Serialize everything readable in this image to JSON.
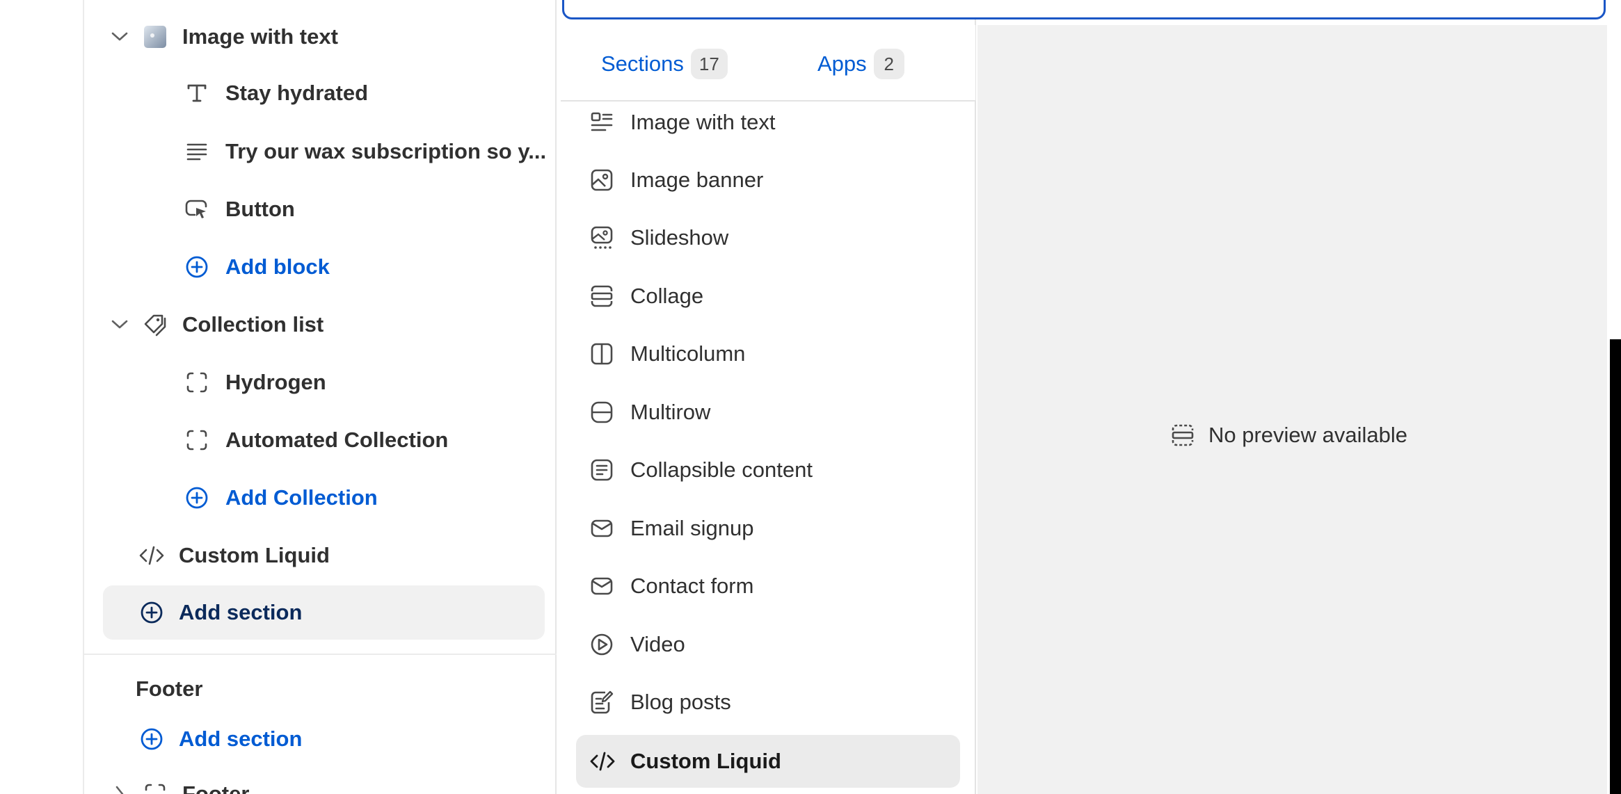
{
  "left_tree": {
    "image_with_text": {
      "label": "Image with text",
      "icon": "image-thumbnail-icon"
    },
    "stay_hydrated": {
      "label": "Stay hydrated",
      "icon": "text-icon"
    },
    "wax_subscription": {
      "label": "Try our wax subscription so y...",
      "icon": "paragraph-icon"
    },
    "button": {
      "label": "Button",
      "icon": "button-cursor-icon"
    },
    "add_block": {
      "label": "Add block",
      "icon": "plus-circle-icon"
    },
    "collection_list": {
      "label": "Collection list",
      "icon": "tag-icon"
    },
    "hydrogen": {
      "label": "Hydrogen",
      "icon": "dashed-square-icon"
    },
    "automated_collection": {
      "label": "Automated Collection",
      "icon": "dashed-square-icon"
    },
    "add_collection": {
      "label": "Add Collection",
      "icon": "plus-circle-icon"
    },
    "custom_liquid": {
      "label": "Custom Liquid",
      "icon": "code-icon"
    },
    "add_section": {
      "label": "Add section",
      "icon": "plus-circle-icon"
    },
    "footer_heading": {
      "label": "Footer"
    },
    "footer_add_section": {
      "label": "Add section",
      "icon": "plus-circle-icon"
    },
    "footer_item": {
      "label": "Footer",
      "icon": "dashed-square-icon"
    }
  },
  "picker": {
    "tabs": [
      {
        "label": "Sections",
        "count": "17"
      },
      {
        "label": "Apps",
        "count": "2"
      }
    ],
    "items": [
      {
        "label": "Image with text",
        "icon": "image-with-text-icon"
      },
      {
        "label": "Image banner",
        "icon": "image-banner-icon"
      },
      {
        "label": "Slideshow",
        "icon": "slideshow-icon"
      },
      {
        "label": "Collage",
        "icon": "collage-icon"
      },
      {
        "label": "Multicolumn",
        "icon": "multicolumn-icon"
      },
      {
        "label": "Multirow",
        "icon": "multirow-icon"
      },
      {
        "label": "Collapsible content",
        "icon": "collapsible-icon"
      },
      {
        "label": "Email signup",
        "icon": "email-icon"
      },
      {
        "label": "Contact form",
        "icon": "email-icon"
      },
      {
        "label": "Video",
        "icon": "play-icon"
      },
      {
        "label": "Blog posts",
        "icon": "blog-icon"
      },
      {
        "label": "Custom Liquid",
        "icon": "code-icon",
        "selected": true
      }
    ]
  },
  "preview": {
    "message": "No preview available",
    "icon": "no-preview-icon"
  },
  "colors": {
    "accent": "#005bd3",
    "selected_bg": "#ebebeb",
    "preview_bg": "#f1f1f1",
    "focus_border": "#1a56c6"
  }
}
